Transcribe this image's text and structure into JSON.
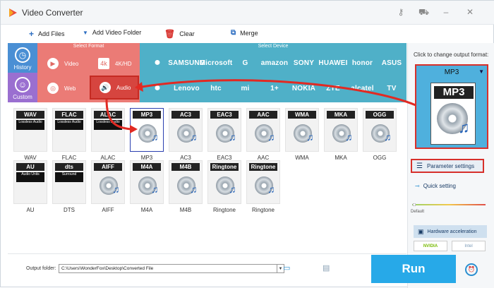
{
  "app": {
    "title": "Video Converter"
  },
  "toolbar": {
    "add_files": "Add Files",
    "add_video_folder": "Add Video Folder",
    "clear": "Clear",
    "merge": "Merge"
  },
  "tabs": {
    "select_format": "Select Format",
    "select_device": "Select Device"
  },
  "side": [
    {
      "label": "History",
      "icon": "clock-icon"
    },
    {
      "label": "Custom",
      "icon": "user-icon"
    }
  ],
  "formats": [
    {
      "label": "Video",
      "icon": "play-icon"
    },
    {
      "label": "4K/HD",
      "icon": "4k-icon"
    },
    {
      "label": "Web",
      "icon": "chrome-icon"
    },
    {
      "label": "Audio",
      "icon": "speaker-icon"
    }
  ],
  "brands_row1": [
    "",
    "SAMSUNG",
    "Microsoft",
    "G",
    "amazon",
    "SONY",
    "HUAWEI",
    "honor",
    "ASUS"
  ],
  "brands_row2": [
    "",
    "Lenovo",
    "htc",
    "mi",
    "1+",
    "NOKIA",
    "ZTE",
    "alcatel",
    "TV"
  ],
  "audio_formats_row1": [
    {
      "badge": "WAV",
      "sub": "Lossless Audio",
      "label": "WAV"
    },
    {
      "badge": "FLAC",
      "sub": "Lossless Audio",
      "label": "FLAC"
    },
    {
      "badge": "ALAC",
      "sub": "Lossless Audio",
      "label": "ALAC"
    },
    {
      "badge": "MP3",
      "sub": "",
      "label": "MP3"
    },
    {
      "badge": "AC3",
      "sub": "",
      "label": "AC3"
    },
    {
      "badge": "EAC3",
      "sub": "",
      "label": "EAC3"
    },
    {
      "badge": "AAC",
      "sub": "",
      "label": "AAC"
    },
    {
      "badge": "WMA",
      "sub": "",
      "label": "WMA"
    },
    {
      "badge": "MKA",
      "sub": "",
      "label": "MKA"
    },
    {
      "badge": "OGG",
      "sub": "",
      "label": "OGG"
    }
  ],
  "audio_formats_row2": [
    {
      "badge": "AU",
      "sub": "Audio Units",
      "label": "AU"
    },
    {
      "badge": "dts",
      "sub": "Surround",
      "label": "DTS"
    },
    {
      "badge": "AIFF",
      "sub": "",
      "label": "AIFF"
    },
    {
      "badge": "M4A",
      "sub": "",
      "label": "M4A"
    },
    {
      "badge": "M4B",
      "sub": "",
      "label": "M4B"
    },
    {
      "badge": "Ringtone",
      "sub": "",
      "label": "Ringtone"
    },
    {
      "badge": "Ringtone",
      "sub": "",
      "label": "Ringtone"
    }
  ],
  "right": {
    "caption": "Click to change output format:",
    "format": "MP3",
    "format_icon_text": "MP3",
    "param": "Parameter settings",
    "quick": "Quick setting",
    "default": "Default",
    "hw": "Hardware acceleration",
    "nvidia": "NVIDIA",
    "intel": "Intel"
  },
  "bottom": {
    "out_label": "Output folder:",
    "out_path": "C:\\Users\\WonderFox\\Desktop\\Converted File",
    "run": "Run"
  },
  "colors": {
    "accent": "#27a9e8",
    "highlight": "#d7302b",
    "format_bg": "#eb7b76",
    "device_bg": "#4fb0c8"
  }
}
